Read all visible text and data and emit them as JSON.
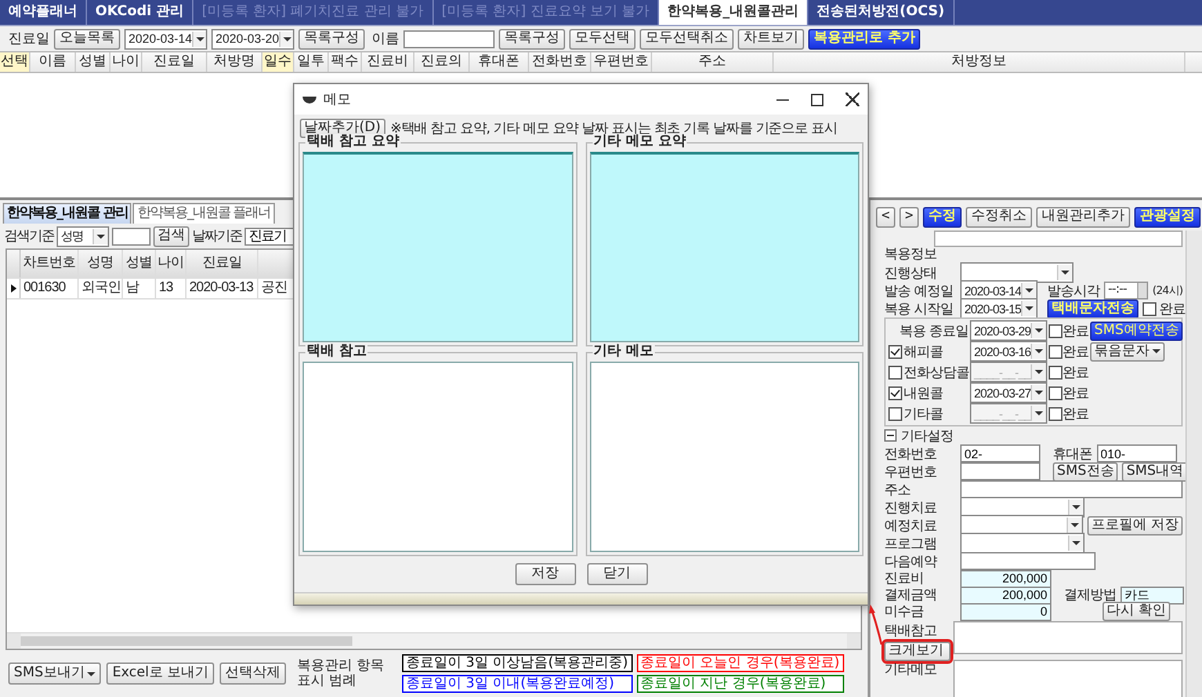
{
  "top_tabs": [
    {
      "label": "예약플래너",
      "selected": false,
      "disabled": false
    },
    {
      "label": "OKCodi 관리",
      "selected": false,
      "disabled": false
    },
    {
      "label": "[미등록 환자] 폐기치진료 관리 불가",
      "selected": false,
      "disabled": true
    },
    {
      "label": "[미등록 환자] 진료요약 보기 불가",
      "selected": false,
      "disabled": true
    },
    {
      "label": "한약복용_내원콜관리",
      "selected": true,
      "disabled": false
    },
    {
      "label": "전송된처방전(OCS)",
      "selected": false,
      "disabled": false
    }
  ],
  "toolbar": [
    {
      "kind": "label",
      "text": "진료일"
    },
    {
      "kind": "button",
      "text": "오늘목록"
    },
    {
      "kind": "date",
      "text": "2020-03-14"
    },
    {
      "kind": "date",
      "text": "2020-03-20"
    },
    {
      "kind": "button",
      "text": "목록구성"
    },
    {
      "kind": "label",
      "text": "이름"
    },
    {
      "kind": "field"
    },
    {
      "kind": "button",
      "text": "목록구성"
    },
    {
      "kind": "button",
      "text": "모두선택"
    },
    {
      "kind": "button",
      "text": "모두선택취소"
    },
    {
      "kind": "button",
      "text": "차트보기"
    },
    {
      "kind": "accent",
      "text": "복용관리로 추가"
    }
  ],
  "grid_columns": [
    {
      "label": "선택",
      "highlighted": true
    },
    {
      "label": "이름",
      "highlighted": false
    },
    {
      "label": "성별",
      "highlighted": false
    },
    {
      "label": "나이",
      "highlighted": false
    },
    {
      "label": "진료일",
      "highlighted": false
    },
    {
      "label": "처방명",
      "highlighted": false
    },
    {
      "label": "일수",
      "highlighted": true
    },
    {
      "label": "일투",
      "highlighted": false
    },
    {
      "label": "팩수",
      "highlighted": false
    },
    {
      "label": "진료비",
      "highlighted": false
    },
    {
      "label": "진료의",
      "highlighted": false
    },
    {
      "label": "휴대폰",
      "highlighted": false
    },
    {
      "label": "전화번호",
      "highlighted": false
    },
    {
      "label": "우편번호",
      "highlighted": false
    },
    {
      "label": "주소",
      "highlighted": false
    },
    {
      "label": "처방정보",
      "highlighted": false
    }
  ],
  "lower_tabs": [
    {
      "label": "한약복용_내원콜 관리",
      "selected": true
    },
    {
      "label": "한약복용_내원콜 플래너",
      "selected": false
    }
  ],
  "search": [
    {
      "kind": "label",
      "text": "검색기준"
    },
    {
      "kind": "combo",
      "text": "성명"
    },
    {
      "kind": "field"
    },
    {
      "kind": "button",
      "text": "검색"
    },
    {
      "kind": "label",
      "text": "날짜기준"
    },
    {
      "kind": "field",
      "text": "진료기"
    }
  ],
  "patient_table": {
    "columns": [
      "차트번호",
      "성명",
      "성별",
      "나이",
      "진료일"
    ],
    "rows": [
      {
        "current": true,
        "cells": [
          "001630",
          "외국인",
          "남",
          "13",
          "2020-03-13",
          "공진"
        ]
      }
    ]
  },
  "bottom_bar": {
    "buttons": [
      {
        "kind": "menu",
        "label": "SMS보내기"
      },
      {
        "kind": "plain",
        "label": "Excel로 보내기"
      },
      {
        "kind": "plain",
        "label": "선택삭제"
      }
    ],
    "legend_label": "복용관리 항목 표시 범례",
    "legend": [
      {
        "text": "종료일이 3일 이상남음(복용관리중)",
        "color": "#000000"
      },
      {
        "text": "종료일이 오늘인 경우(복용완료)",
        "color": "#ff0000"
      },
      {
        "text": "종료일이 3일 이내(복용완료예정)",
        "color": "#0000ff"
      },
      {
        "text": "종료일이 지난 경우(복용완료)",
        "color": "#008000"
      }
    ]
  },
  "right_nav": [
    {
      "kind": "arrow",
      "label": "<"
    },
    {
      "kind": "arrow",
      "label": ">"
    },
    {
      "kind": "accent",
      "label": "수정"
    },
    {
      "kind": "plain",
      "label": "수정취소"
    },
    {
      "kind": "plain",
      "label": "내원관리추가"
    },
    {
      "kind": "accent",
      "label": "관광설정"
    }
  ],
  "dosing": {
    "title": "복용정보",
    "status_label": "진행상태",
    "send_date_label": "발송 예정일",
    "send_date": "2020-03-14",
    "send_time_label": "발송시각",
    "send_time": "--:--",
    "time_hint": "(24시)",
    "start_label": "복용 시작일",
    "start_date": "2020-03-15",
    "courier_sms_button": "택배문자전송",
    "done_label": "완료",
    "done": false
  },
  "calls": [
    {
      "kind": "end",
      "label": "복용 종료일",
      "date": "2020-03-29",
      "done_label": "완료",
      "done": false,
      "button": {
        "kind": "accent",
        "label": "SMS예약전송"
      }
    },
    {
      "kind": "check",
      "label": "해피콜",
      "checked": true,
      "date": "2020-03-16",
      "done_label": "완료",
      "done": false,
      "button": {
        "kind": "menu",
        "label": "묶음문자"
      }
    },
    {
      "kind": "check",
      "label": "전화상담콜",
      "checked": false,
      "date": "____-__-__",
      "done_label": "완료",
      "done": false
    },
    {
      "kind": "check",
      "label": "내원콜",
      "checked": true,
      "date": "2020-03-27",
      "done_label": "완료",
      "done": false
    },
    {
      "kind": "check",
      "label": "기타콜",
      "checked": false,
      "date": "____-__-__",
      "done_label": "완료",
      "done": false
    }
  ],
  "misc": {
    "title": "기타설정",
    "expanded": true,
    "phone_label": "전화번호",
    "phone": "02-",
    "mobile_label": "휴대폰",
    "mobile": "010-",
    "zip_label": "우편번호",
    "sms_send": "SMS전송",
    "sms_history": "SMS내역",
    "address_label": "주소",
    "treat_label": "진행치료",
    "plan_label": "예정치료",
    "profile_button": "프로필에 저장",
    "program_label": "프로그램",
    "next_label": "다음예약",
    "fee_label": "진료비",
    "fee": "200,000",
    "paid_label": "결제금액",
    "paid": "200,000",
    "method_label": "결제방법",
    "method": "카드",
    "unpaid_label": "미수금",
    "unpaid": "0",
    "recheck_button": "다시 확인",
    "courier_label": "택배참고",
    "enlarge_button": "크게보기",
    "enlarge_highlighted": true,
    "memo_label": "기타메모"
  },
  "dialog": {
    "title": "메모",
    "add_date_button": "날짜추가(D)",
    "note": "※택배 참고 요약, 기타 메모 요약 날짜 표시는 최초 기록 날짜를 기준으로 표시",
    "panels": [
      {
        "title": "택배 참고 요약",
        "kind": "summary"
      },
      {
        "title": "기타 메모 요약",
        "kind": "summary"
      },
      {
        "title": "택배 참고",
        "kind": "edit"
      },
      {
        "title": "기타 메모",
        "kind": "edit"
      }
    ],
    "buttons": [
      "저장",
      "닫기"
    ]
  }
}
